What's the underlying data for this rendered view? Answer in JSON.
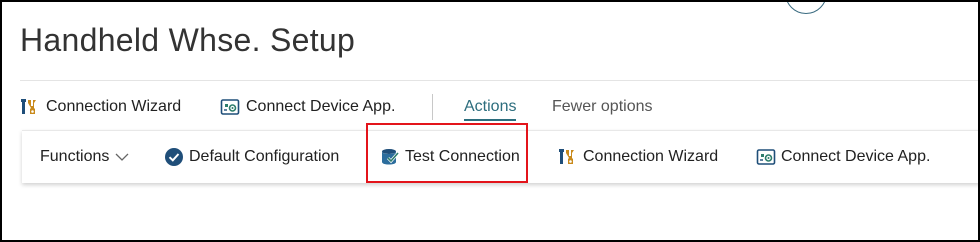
{
  "page": {
    "title": "Handheld Whse. Setup"
  },
  "promoted": {
    "connection_wizard": "Connection Wizard",
    "connect_device_app": "Connect Device App.",
    "actions_tab": "Actions",
    "fewer_options": "Fewer options"
  },
  "action_bar": {
    "functions": "Functions",
    "default_configuration": "Default Configuration",
    "test_connection": "Test Connection",
    "connection_wizard": "Connection Wizard",
    "connect_device_app": "Connect Device App."
  },
  "colors": {
    "accent": "#2c6d7d",
    "highlight_border": "#e3141b"
  },
  "icons": {
    "wizard": "tools-wizard-icon",
    "device_app": "device-gear-icon",
    "check": "check-circle-icon",
    "test": "database-check-icon",
    "chevron": "chevron-down-icon"
  }
}
